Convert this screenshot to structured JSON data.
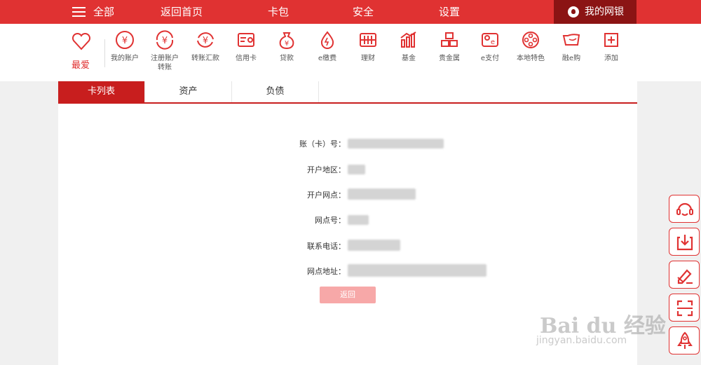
{
  "topnav": {
    "all_label": "全部",
    "items": [
      "返回首页",
      "卡包",
      "安全",
      "设置"
    ],
    "mybank_label": "我的网银"
  },
  "iconbar": {
    "favorite_label": "最爱",
    "items": [
      {
        "label": "我的账户",
        "icon": "yen-coin-icon"
      },
      {
        "label": "注册账户转账",
        "icon": "yen-transfer-icon"
      },
      {
        "label": "转账汇款",
        "icon": "yen-remit-icon"
      },
      {
        "label": "信用卡",
        "icon": "credit-card-icon"
      },
      {
        "label": "贷款",
        "icon": "money-bag-icon"
      },
      {
        "label": "e缴费",
        "icon": "water-drop-icon"
      },
      {
        "label": "理财",
        "icon": "abacus-icon"
      },
      {
        "label": "基金",
        "icon": "bar-chart-icon"
      },
      {
        "label": "贵金属",
        "icon": "gold-bars-icon"
      },
      {
        "label": "e支付",
        "icon": "epay-icon"
      },
      {
        "label": "本地特色",
        "icon": "film-reel-icon"
      },
      {
        "label": "融e购",
        "icon": "shopping-icon"
      },
      {
        "label": "添加",
        "icon": "plus-box-icon"
      }
    ]
  },
  "tabs": [
    {
      "label": "卡列表",
      "active": true
    },
    {
      "label": "资产",
      "active": false
    },
    {
      "label": "负债",
      "active": false
    }
  ],
  "detail": {
    "fields": [
      {
        "label": "账（卡）号："
      },
      {
        "label": "开户地区："
      },
      {
        "label": "开户网点："
      },
      {
        "label": "网点号："
      },
      {
        "label": "联系电话："
      },
      {
        "label": "网点地址："
      }
    ],
    "back_label": "返回"
  },
  "float_toolbar": [
    "headset-icon",
    "download-icon",
    "edit-icon",
    "scan-icon",
    "rocket-icon"
  ],
  "watermark": {
    "main": "Bai du 经验",
    "sub": "jingyan.baidu.com"
  },
  "colors": {
    "primary": "#e03232",
    "dark": "#8b1414",
    "tab_active": "#c81e1e"
  }
}
